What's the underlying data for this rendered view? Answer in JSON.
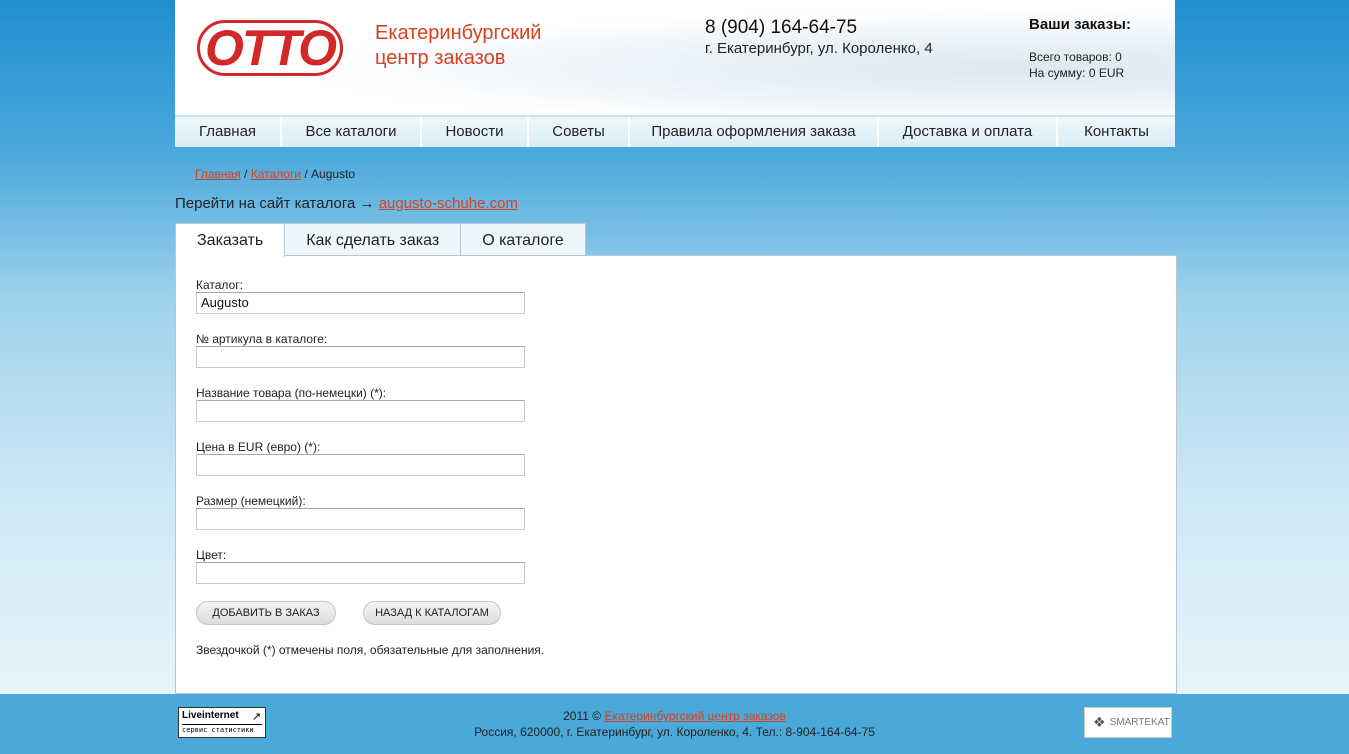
{
  "header": {
    "logo_text": "OTTO",
    "brand_line1": "Екатеринбургский",
    "brand_line2": "центр заказов",
    "phone": "8 (904) 164-64-75",
    "address": "г. Екатеринбург, ул. Короленко, 4"
  },
  "cart": {
    "title": "Ваши заказы:",
    "items_line": "Всего товаров: 0",
    "sum_line": "На сумму: 0 EUR"
  },
  "nav": {
    "items": [
      {
        "label": "Главная"
      },
      {
        "label": "Все каталоги"
      },
      {
        "label": "Новости"
      },
      {
        "label": "Советы"
      },
      {
        "label": "Правила оформления заказа"
      },
      {
        "label": "Доставка и оплата"
      },
      {
        "label": "Контакты"
      }
    ]
  },
  "breadcrumb": {
    "home": "Главная",
    "sep1": " / ",
    "catalogs": "Каталоги",
    "sep2": " / ",
    "current": "Augusto"
  },
  "goto": {
    "text": "Перейти на сайт каталога → ",
    "link": "augusto-schuhe.com"
  },
  "tabs": [
    {
      "label": "Заказать",
      "active": true
    },
    {
      "label": "Как сделать заказ",
      "active": false
    },
    {
      "label": "О каталоге",
      "active": false
    }
  ],
  "form": {
    "fields": [
      {
        "label": "Каталог:",
        "value": ""
      },
      {
        "label": "№ артикула в каталоге:",
        "value": ""
      },
      {
        "label": "Название товара (по-немецки) (*):",
        "value": ""
      },
      {
        "label": "Цена в EUR (евро) (*):",
        "value": ""
      },
      {
        "label": "Размер (немецкий):",
        "value": ""
      },
      {
        "label": "Цвет:",
        "value": ""
      }
    ],
    "catalog_value": "Augusto",
    "add_button": "Добавить в заказ",
    "back_button": "Назад к каталогам",
    "note": "Звездочкой (*) отмечены поля, обязательные для заполнения."
  },
  "footer": {
    "counter_line1": "Liveinternet",
    "counter_line2": "сервис статистики",
    "copyright_prefix": "2011 © ",
    "copyright_link": "Екатеринбургский центр заказов",
    "address_line": "Россия, 620000, г. Екатеринбург, ул. Короленко, 4. Тел.: 8-904-164-64-75",
    "partner_logo": "SMARTEKAT"
  },
  "colors": {
    "accent": "#d9401e",
    "logo_red": "#d42828",
    "footer_bg": "#4aa9d9"
  }
}
